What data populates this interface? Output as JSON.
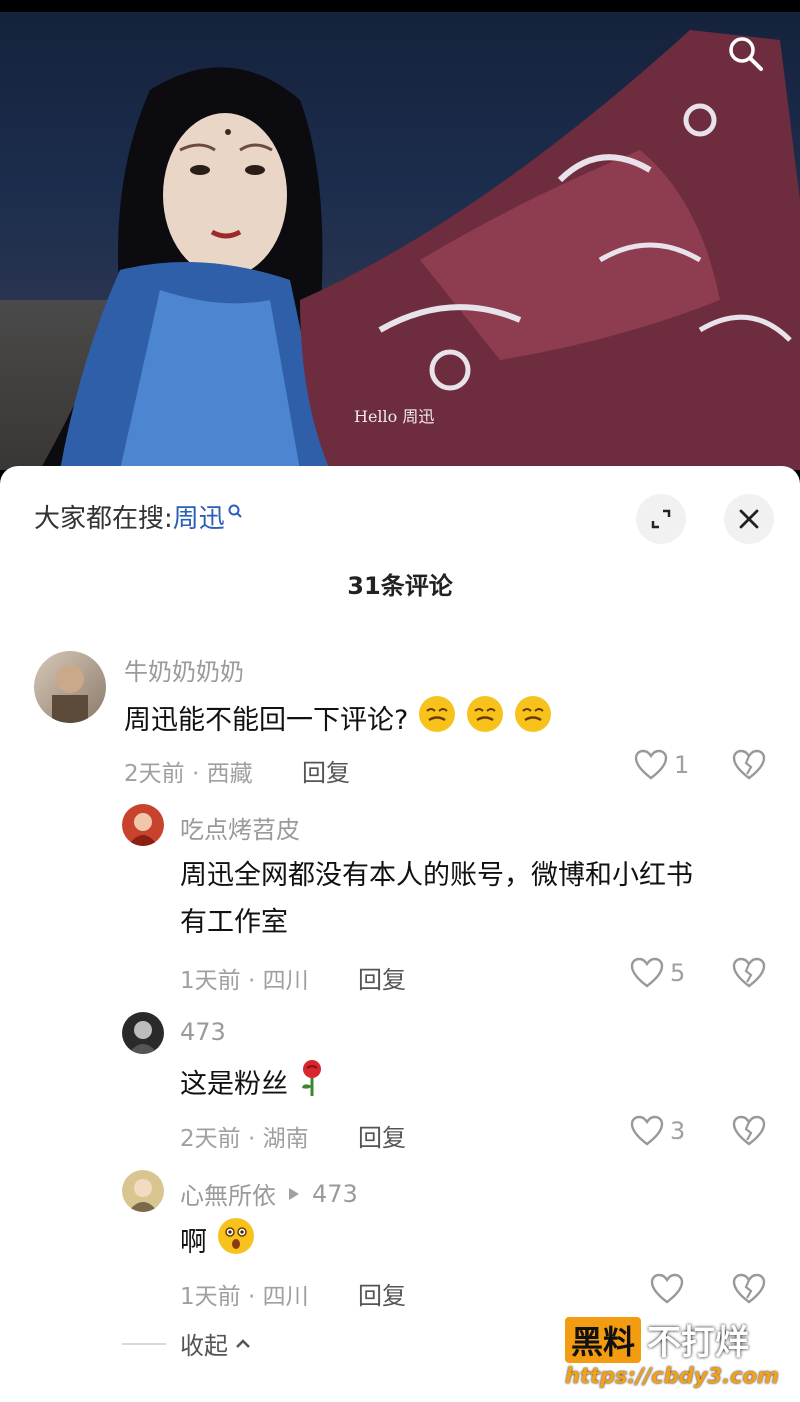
{
  "video": {
    "caption": "Hello 周迅"
  },
  "panel": {
    "hot_search_prefix": "大家都在搜:",
    "hot_search_keyword": "周迅",
    "comment_count_label": "31条评论",
    "collapse_label": "收起"
  },
  "comments": [
    {
      "user": "牛奶奶奶奶",
      "text": "周迅能不能回一下评论?",
      "time_loc": "2天前 · 西藏",
      "reply": "回复",
      "likes": "1",
      "emoji": "smiling-face-emoji"
    },
    {
      "user": "吃点烤苕皮",
      "text_line1": "周迅全网都没有本人的账号，微博和小红书",
      "text_line2": "有工作室",
      "time_loc": "1天前 · 四川",
      "reply": "回复",
      "likes": "5"
    },
    {
      "user": "473",
      "text": "这是粉丝",
      "time_loc": "2天前 · 湖南",
      "reply": "回复",
      "likes": "3",
      "emoji": "rose-emoji"
    },
    {
      "user": "心無所依",
      "reply_to": "473",
      "text": "啊",
      "time_loc": "1天前 · 四川",
      "reply": "回复",
      "likes": "",
      "emoji": "surprised-face-emoji"
    }
  ],
  "watermark": {
    "box_text": "黑料",
    "side_text": "不打烊",
    "url": "https://cbdy3.com"
  },
  "colors": {
    "keyword": "#2b5eb7",
    "watermark_orange": "#f39c12"
  }
}
